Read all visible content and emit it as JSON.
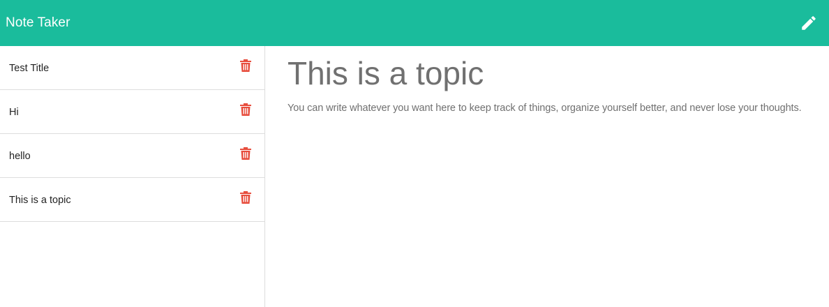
{
  "app": {
    "title": "Note Taker",
    "accent_color": "#1abc9c",
    "delete_color": "#e74c3c"
  },
  "header": {
    "new_note_icon": "pencil-icon"
  },
  "notes": [
    {
      "title": "Test Title",
      "delete_icon": "trash-icon"
    },
    {
      "title": "Hi",
      "delete_icon": "trash-icon"
    },
    {
      "title": "hello",
      "delete_icon": "trash-icon"
    },
    {
      "title": "This is a topic",
      "delete_icon": "trash-icon"
    }
  ],
  "active_note": {
    "title": "This is a topic",
    "text": "You can write whatever you want here to keep track of things, organize yourself better, and never lose your thoughts."
  }
}
